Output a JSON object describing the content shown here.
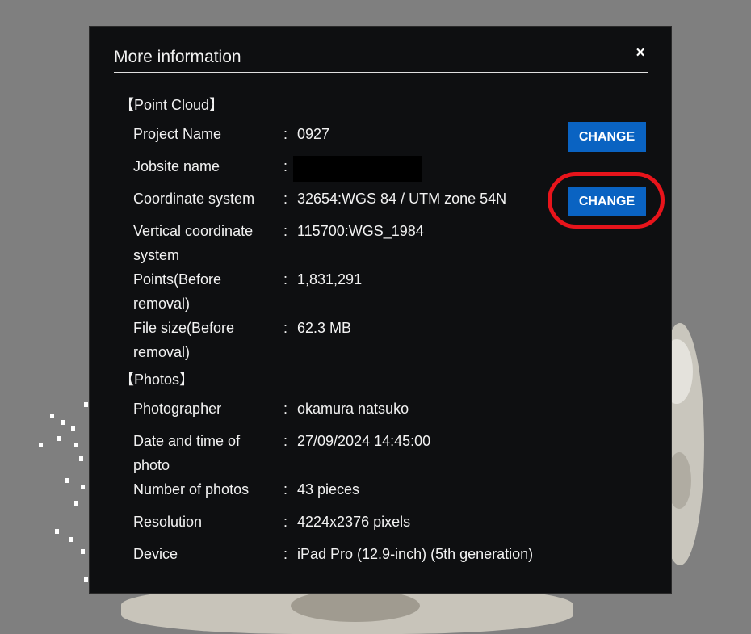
{
  "dialog": {
    "title": "More information",
    "close_label": "×",
    "point_cloud_heading": "【Point Cloud】",
    "photos_heading": "【Photos】",
    "separator": ":",
    "change_label": "CHANGE"
  },
  "point_cloud": {
    "project_name": {
      "label": "Project Name",
      "value": "0927"
    },
    "jobsite_name": {
      "label": "Jobsite name",
      "value": ""
    },
    "coordinate_system": {
      "label": "Coordinate system",
      "value": "32654:WGS 84 / UTM zone 54N"
    },
    "vertical_coordinate_system": {
      "label_1": "Vertical coordinate",
      "label_2": "system",
      "value": "115700:WGS_1984"
    },
    "points": {
      "label_1": "Points(Before",
      "label_2": "removal)",
      "value": "1,831,291"
    },
    "file_size": {
      "label_1": "File size(Before",
      "label_2": "removal)",
      "value": "62.3 MB"
    }
  },
  "photos": {
    "photographer": {
      "label": "Photographer",
      "value": "okamura natsuko"
    },
    "date_time": {
      "label_1": "Date and time of",
      "label_2": "photo",
      "value": "27/09/2024 14:45:00"
    },
    "number_of_photos": {
      "label": "Number of photos",
      "value": "43 pieces"
    },
    "resolution": {
      "label": "Resolution",
      "value": "4224x2376 pixels"
    },
    "device": {
      "label": "Device",
      "value": "iPad Pro (12.9-inch) (5th generation)"
    }
  },
  "colors": {
    "overlay": "#7f7f7f",
    "dialog_background": "#0e0f11",
    "button": "#0a63c2",
    "highlight": "#e8141b"
  }
}
